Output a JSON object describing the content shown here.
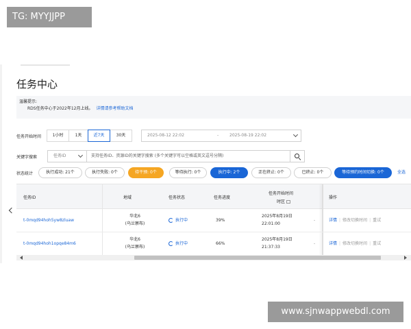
{
  "watermarks": {
    "top": "TG: MYYJJPP",
    "bottom": "www.sjnwappwebdl.com"
  },
  "page": {
    "title": "任务中心"
  },
  "notice": {
    "title": "温馨提示:",
    "body": "RDS任务中心于2022年12月上线。",
    "link": "详情请参考帮助文档"
  },
  "filters": {
    "time_label": "任务开始时间",
    "time_buttons": [
      {
        "label": "1小时",
        "active": false
      },
      {
        "label": "1天",
        "active": false
      },
      {
        "label": "近7天",
        "active": true
      },
      {
        "label": "30天",
        "active": false
      }
    ],
    "date_start": "2025-08-12 22:02",
    "date_sep": "-",
    "date_end": "2025-08-19 22:02",
    "keyword_label": "关键字搜索",
    "keyword_type": "任务ID",
    "keyword_placeholder": "支持任务ID、资源ID的关键字搜索 (多个关键字可以空格或英文逗号分隔)"
  },
  "stats": {
    "label": "状态统计",
    "pills": [
      {
        "label": "执行成功: 21个",
        "style": "default"
      },
      {
        "label": "执行失败: 0个",
        "style": "default"
      },
      {
        "label": "待干预: 0个",
        "style": "orange"
      },
      {
        "label": "等待执行: 0个",
        "style": "default"
      },
      {
        "label": "执行中: 2个",
        "style": "blue"
      },
      {
        "label": "正在终止: 0个",
        "style": "default"
      },
      {
        "label": "已终止: 0个",
        "style": "default"
      },
      {
        "label": "等待预约时间切换: 0个",
        "style": "blue"
      }
    ],
    "all_label": "全选"
  },
  "table": {
    "headers": {
      "task_id": "任务ID",
      "region": "地域",
      "status": "任务状态",
      "progress": "任务进度",
      "start_time": "任务开始时间",
      "timezone": "时区",
      "actions": "操作"
    },
    "rows": [
      {
        "task_id": "t-0mqd94hoh5yw8zluaw",
        "region_line1": "华北6",
        "region_line2": "(乌兰察布)",
        "status": "执行中",
        "progress": "39%",
        "date": "2025年8月19日",
        "time": "22:01:00",
        "dash": "-",
        "actions": {
          "detail": "详情",
          "modify": "修改切换时间",
          "retry": "重试"
        }
      },
      {
        "task_id": "t-0mqd94hoh1opqe84m6",
        "region_line1": "华北6",
        "region_line2": "(乌兰察布)",
        "status": "执行中",
        "progress": "66%",
        "date": "2025年8月19日",
        "time": "21:37:33",
        "dash": "-",
        "actions": {
          "detail": "详情",
          "modify": "修改切换时间",
          "retry": "重试"
        }
      }
    ]
  },
  "colors": {
    "accent": "#1a66d6",
    "warning": "#f5a623",
    "watermark_bg": "#9a9a9a"
  }
}
